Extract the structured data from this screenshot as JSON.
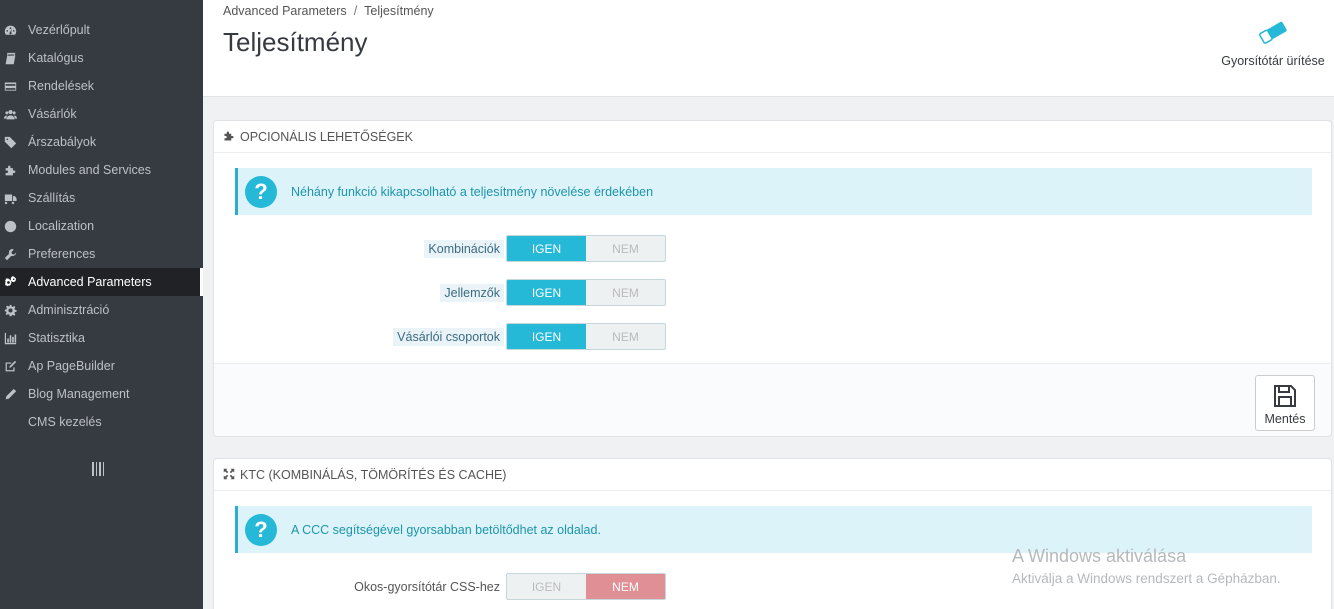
{
  "sidebar": {
    "items": [
      {
        "label": "Vezérlőpult",
        "icon": "dashboard-icon"
      },
      {
        "label": "Katalógus",
        "icon": "book-icon"
      },
      {
        "label": "Rendelések",
        "icon": "credit-card-icon"
      },
      {
        "label": "Vásárlók",
        "icon": "users-icon"
      },
      {
        "label": "Árszabályok",
        "icon": "tags-icon"
      },
      {
        "label": "Modules and Services",
        "icon": "puzzle-icon"
      },
      {
        "label": "Szállítás",
        "icon": "truck-icon"
      },
      {
        "label": "Localization",
        "icon": "globe-icon"
      },
      {
        "label": "Preferences",
        "icon": "wrench-icon"
      },
      {
        "label": "Advanced Parameters",
        "icon": "cogs-icon",
        "active": true
      },
      {
        "label": "Adminisztráció",
        "icon": "gear-icon"
      },
      {
        "label": "Statisztika",
        "icon": "bar-chart-icon"
      },
      {
        "label": "Ap PageBuilder",
        "icon": "edit-icon"
      },
      {
        "label": "Blog Management",
        "icon": "pencil-icon"
      },
      {
        "label": "CMS kezelés",
        "icon": ""
      }
    ],
    "collapse_icon": "collapse-bars-icon"
  },
  "header": {
    "breadcrumb": [
      "Advanced Parameters",
      "Teljesítmény"
    ],
    "breadcrumb_separator": "/",
    "title": "Teljesítmény",
    "clear_cache_label": "Gyorsítótár ürítése",
    "clear_cache_icon": "eraser-icon"
  },
  "optional_panel": {
    "heading": "OPCIONÁLIS LEHETŐSÉGEK",
    "heading_icon": "puzzle-icon",
    "alert": "Néhány funkció kikapcsolható a teljesítmény növelése érdekében",
    "rows": [
      {
        "label": "Kombinációk",
        "yes": "IGEN",
        "no": "NEM",
        "value": "yes"
      },
      {
        "label": "Jellemzők",
        "yes": "IGEN",
        "no": "NEM",
        "value": "yes"
      },
      {
        "label": "Vásárlói csoportok",
        "yes": "IGEN",
        "no": "NEM",
        "value": "yes"
      }
    ],
    "save_label": "Mentés",
    "save_icon": "floppy-icon"
  },
  "ccc_panel": {
    "heading": "KTC (KOMBINÁLÁS, TÖMÖRÍTÉS ÉS CACHE)",
    "heading_icon": "expand-icon",
    "alert": "A CCC segítségével gyorsabban betöltődhet az oldalad.",
    "rows": [
      {
        "label": "Okos-gyorsítótár CSS-hez",
        "yes": "IGEN",
        "no": "NEM",
        "value": "no"
      }
    ]
  },
  "watermark": {
    "title": "A Windows aktiválása",
    "subtitle": "Aktiválja a Windows rendszert a Gépházban."
  },
  "colors": {
    "sidebar_bg": "#363a41",
    "accent": "#25b9d7",
    "danger": "#e08f95"
  }
}
